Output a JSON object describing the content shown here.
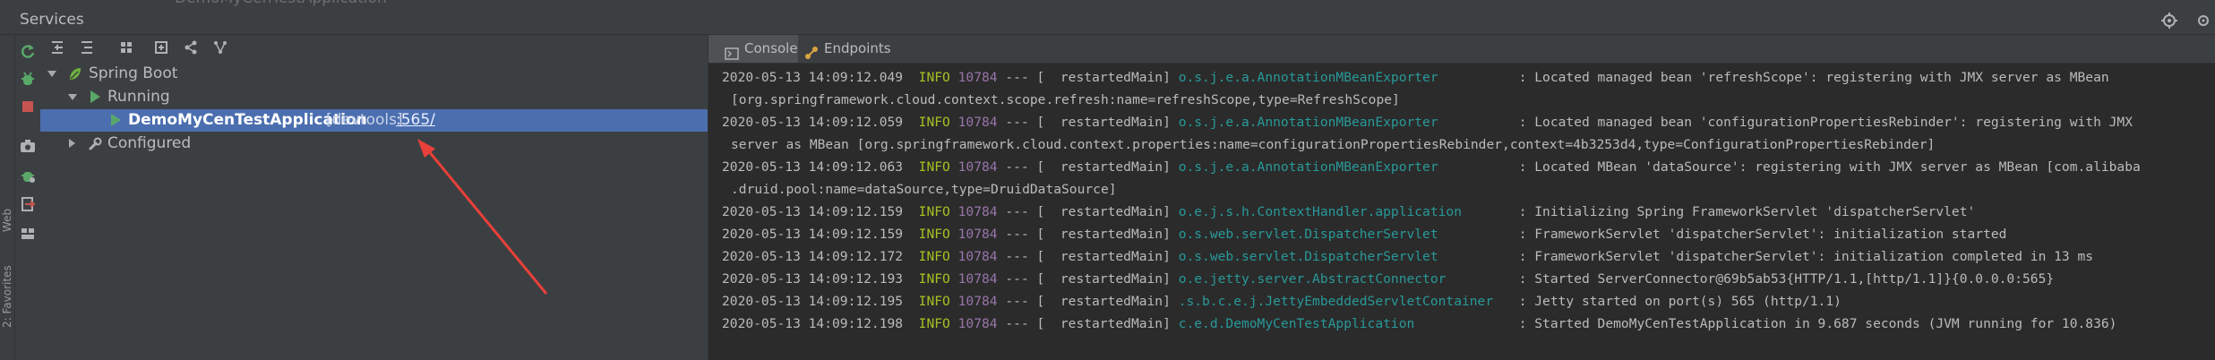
{
  "window": {
    "title": "Services",
    "behind_tab": "DemoMyCenTestApplication"
  },
  "left_stripe": {
    "label_web": "Web",
    "label_favorites": "2: Favorites"
  },
  "tree": {
    "items": [
      {
        "label": "Spring Boot"
      },
      {
        "label": "Running"
      },
      {
        "app": "DemoMyCenTestApplication",
        "tag": "[devtools]",
        "port": ":565/"
      },
      {
        "label": "Configured"
      }
    ]
  },
  "tabs": [
    {
      "label": "Console"
    },
    {
      "label": "Endpoints"
    }
  ],
  "log": [
    {
      "ts": "2020-05-13 14:09:12.049",
      "level": "INFO",
      "pid": "10784",
      "sep": "---",
      "thread": "[  restartedMain]",
      "logger": "o.s.j.e.a.AnnotationMBeanExporter",
      "msg": ": Located managed bean 'refreshScope': registering with JMX server as MBean"
    },
    {
      "cont": "[org.springframework.cloud.context.scope.refresh:name=refreshScope,type=RefreshScope]"
    },
    {
      "ts": "2020-05-13 14:09:12.059",
      "level": "INFO",
      "pid": "10784",
      "sep": "---",
      "thread": "[  restartedMain]",
      "logger": "o.s.j.e.a.AnnotationMBeanExporter",
      "msg": ": Located managed bean 'configurationPropertiesRebinder': registering with JMX"
    },
    {
      "cont": "server as MBean [org.springframework.cloud.context.properties:name=configurationPropertiesRebinder,context=4b3253d4,type=ConfigurationPropertiesRebinder]"
    },
    {
      "ts": "2020-05-13 14:09:12.063",
      "level": "INFO",
      "pid": "10784",
      "sep": "---",
      "thread": "[  restartedMain]",
      "logger": "o.s.j.e.a.AnnotationMBeanExporter",
      "msg": ": Located MBean 'dataSource': registering with JMX server as MBean [com.alibaba"
    },
    {
      "cont": ".druid.pool:name=dataSource,type=DruidDataSource]"
    },
    {
      "ts": "2020-05-13 14:09:12.159",
      "level": "INFO",
      "pid": "10784",
      "sep": "---",
      "thread": "[  restartedMain]",
      "logger": "o.e.j.s.h.ContextHandler.application",
      "msg": ": Initializing Spring FrameworkServlet 'dispatcherServlet'"
    },
    {
      "ts": "2020-05-13 14:09:12.159",
      "level": "INFO",
      "pid": "10784",
      "sep": "---",
      "thread": "[  restartedMain]",
      "logger": "o.s.web.servlet.DispatcherServlet",
      "msg": ": FrameworkServlet 'dispatcherServlet': initialization started"
    },
    {
      "ts": "2020-05-13 14:09:12.172",
      "level": "INFO",
      "pid": "10784",
      "sep": "---",
      "thread": "[  restartedMain]",
      "logger": "o.s.web.servlet.DispatcherServlet",
      "msg": ": FrameworkServlet 'dispatcherServlet': initialization completed in 13 ms"
    },
    {
      "ts": "2020-05-13 14:09:12.193",
      "level": "INFO",
      "pid": "10784",
      "sep": "---",
      "thread": "[  restartedMain]",
      "logger": "o.e.jetty.server.AbstractConnector",
      "msg": ": Started ServerConnector@69b5ab53{HTTP/1.1,[http/1.1]}{0.0.0.0:565}"
    },
    {
      "ts": "2020-05-13 14:09:12.195",
      "level": "INFO",
      "pid": "10784",
      "sep": "---",
      "thread": "[  restartedMain]",
      "logger": ".s.b.c.e.j.JettyEmbeddedServletContainer",
      "msg": ": Jetty started on port(s) 565 (http/1.1)"
    },
    {
      "ts": "2020-05-13 14:09:12.198",
      "level": "INFO",
      "pid": "10784",
      "sep": "---",
      "thread": "[  restartedMain]",
      "logger": "c.e.d.DemoMyCenTestApplication",
      "msg": ": Started DemoMyCenTestApplication in 9.687 seconds (JVM running for 10.836)"
    }
  ],
  "colors": {
    "selection": "#4b6eaf",
    "info_level": "#a8c023",
    "pid": "#9876aa",
    "logger": "#299999",
    "run_green": "#59a869",
    "stop_red": "#c75450",
    "annotation_arrow": "#e8403a"
  }
}
